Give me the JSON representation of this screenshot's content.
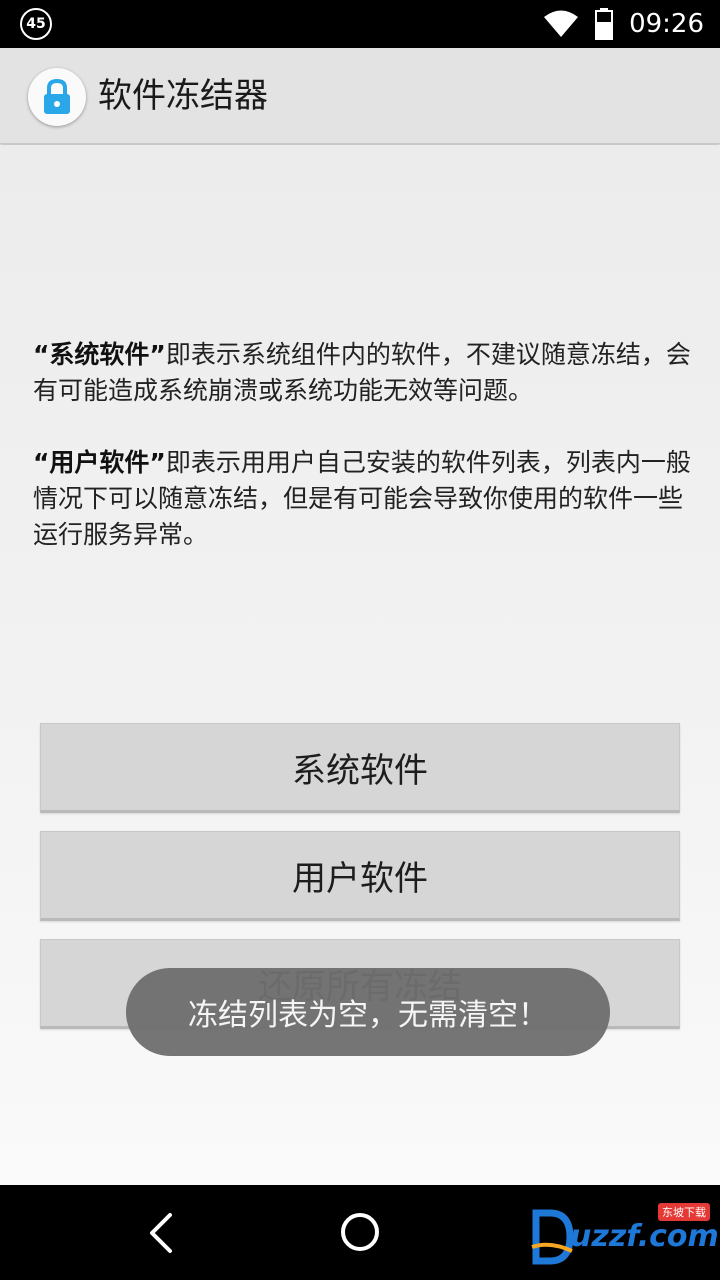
{
  "status_bar": {
    "notification_count": "45",
    "time": "09:26",
    "icons": [
      "wifi-icon",
      "battery-icon"
    ]
  },
  "app_bar": {
    "title": "软件冻结器",
    "icon": "lock-icon"
  },
  "descriptions": {
    "system": {
      "term": "“系统软件”",
      "text": "即表示系统组件内的软件，不建议随意冻结，会有可能造成系统崩溃或系统功能无效等问题。"
    },
    "user": {
      "term": "“用户软件”",
      "text": "即表示用用户自己安装的软件列表，列表内一般情况下可以随意冻结，但是有可能会导致你使用的软件一些运行服务异常。"
    }
  },
  "buttons": {
    "system": "系统软件",
    "user": "用户软件",
    "restore": "还原所有冻结"
  },
  "toast": "冻结列表为空，无需清空！",
  "watermark": {
    "text": "uzzf.com",
    "badge": "东坡下载"
  },
  "colors": {
    "accent": "#2aa7e8",
    "toast_bg": "#6e6e6e",
    "button_bg": "#d6d6d6"
  }
}
